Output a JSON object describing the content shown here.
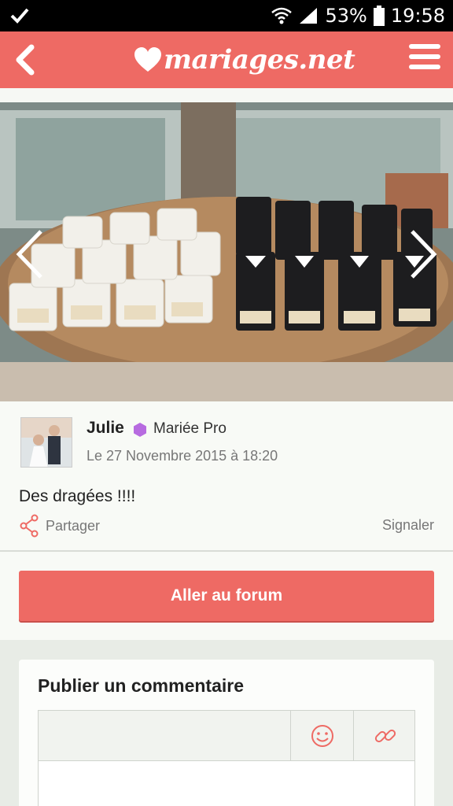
{
  "status_bar": {
    "battery": "53%",
    "time": "19:58"
  },
  "header": {
    "logo": "mariages.net"
  },
  "post": {
    "author": "Julie",
    "role": "Mariée Pro",
    "date": "Le 27 Novembre 2015 à 18:20",
    "message": "Des dragées !!!!",
    "share_label": "Partager",
    "report_label": "Signaler"
  },
  "forum_button": "Aller au forum",
  "comment": {
    "title": "Publier un commentaire"
  },
  "colors": {
    "brand": "#ee6a64",
    "badge": "#b76be0"
  },
  "icons": [
    "check-icon",
    "wifi-icon",
    "signal-icon",
    "battery-icon",
    "back-icon",
    "heart-logo-icon",
    "menu-icon",
    "chevron-left-icon",
    "chevron-right-icon",
    "badge-icon",
    "share-icon",
    "smiley-icon",
    "link-icon"
  ]
}
